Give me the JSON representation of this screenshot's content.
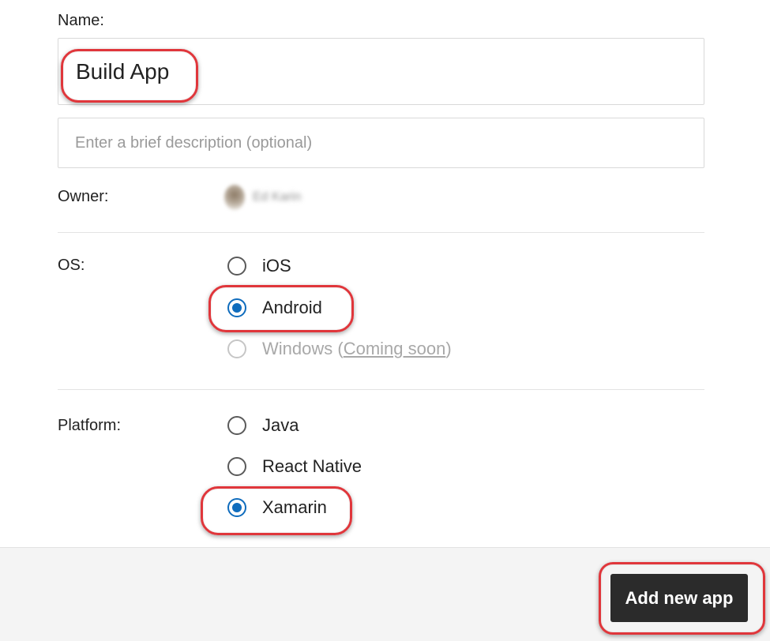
{
  "form": {
    "name_label": "Name:",
    "name_value": "Build App",
    "description_placeholder": "Enter a brief description (optional)",
    "owner_label": "Owner:",
    "owner_name": "Ed Karin"
  },
  "os": {
    "label": "OS:",
    "options": [
      {
        "label": "iOS",
        "selected": false,
        "disabled": false
      },
      {
        "label": "Android",
        "selected": true,
        "disabled": false
      },
      {
        "label": "Windows",
        "selected": false,
        "disabled": true
      }
    ],
    "windows_suffix_open": " (",
    "windows_link": "Coming soon",
    "windows_suffix_close": ")"
  },
  "platform": {
    "label": "Platform:",
    "options": [
      {
        "label": "Java",
        "selected": false
      },
      {
        "label": "React Native",
        "selected": false
      },
      {
        "label": "Xamarin",
        "selected": true
      }
    ]
  },
  "footer": {
    "add_button_label": "Add new app"
  },
  "colors": {
    "accent": "#0f6cbd",
    "highlight": "#e0363b",
    "button_bg": "#2b2b2b"
  }
}
